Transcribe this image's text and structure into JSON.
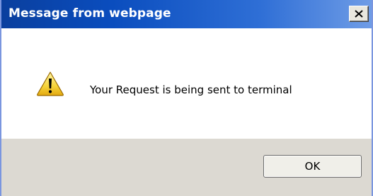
{
  "dialog": {
    "title": "Message from webpage",
    "message": "Your Request is being sent to terminal",
    "ok_label": "OK",
    "close_label": "X",
    "icon": "warning-icon"
  }
}
